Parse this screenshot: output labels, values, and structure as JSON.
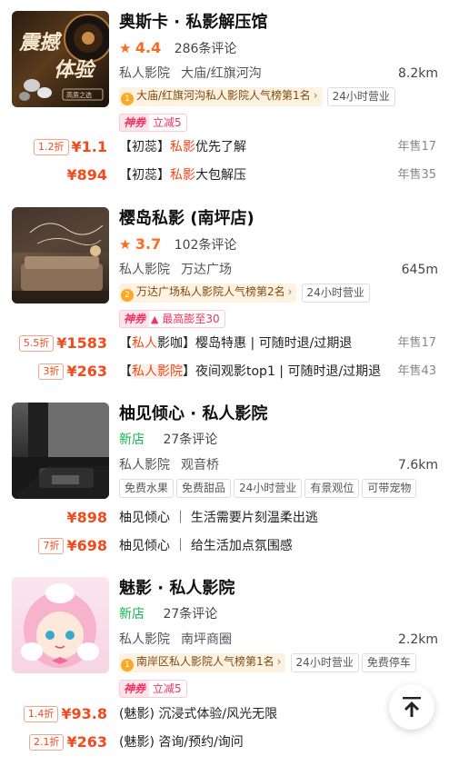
{
  "shops": [
    {
      "name": "奥斯卡 · 私影解压馆",
      "rating": "4.4",
      "reviews": "286条评论",
      "category": "私人影院",
      "area": "大庙/红旗河沟",
      "distance": "8.2km",
      "rank": "大庙/红旗河沟私人影院人气榜第1名",
      "tags": [
        "24小时营业"
      ],
      "promo": {
        "label": "神券",
        "value": "立减5"
      },
      "thumb_text": [
        "震撼",
        "体验",
        "高质之选"
      ],
      "deals": [
        {
          "discount": "1.2折",
          "price": "¥1.1",
          "prefix": "【初蕊】",
          "highlight": "私影",
          "suffix": "优先了解",
          "sold": "年售17"
        },
        {
          "discount": "",
          "price": "¥894",
          "prefix": "【初蕊】",
          "highlight": "私影",
          "suffix": "大包解压",
          "sold": "年售35"
        }
      ]
    },
    {
      "name": "樱岛私影 (南坪店)",
      "rating": "3.7",
      "reviews": "102条评论",
      "category": "私人影院",
      "area": "万达广场",
      "distance": "645m",
      "rank": "万达广场私人影院人气榜第2名",
      "tags": [
        "24小时营业"
      ],
      "promo": {
        "label": "神券",
        "value": "最高膨至30"
      },
      "deals": [
        {
          "discount": "5.5折",
          "price": "¥1583",
          "prefix": "【",
          "highlight": "私人",
          "suffix": "影咖】樱岛特惠 | 可随时退/过期退",
          "sold": "年售17"
        },
        {
          "discount": "3折",
          "price": "¥263",
          "prefix": "【",
          "highlight": "私人影院",
          "suffix": "】夜间观影top1 | 可随时退/过期退",
          "sold": "年售43"
        }
      ]
    },
    {
      "name": "柚见倾心 · 私人影院",
      "new": "新店",
      "reviews": "27条评论",
      "category": "私人影院",
      "area": "观音桥",
      "distance": "7.6km",
      "tags": [
        "免费水果",
        "免费甜品",
        "24小时营业",
        "有景观位",
        "可带宠物"
      ],
      "deals": [
        {
          "discount": "",
          "price": "¥898",
          "prefix": "柚见倾心 ｜ 生活需要片刻温柔出逃",
          "highlight": "",
          "suffix": "",
          "sold": ""
        },
        {
          "discount": "7折",
          "price": "¥698",
          "prefix": "柚见倾心 ｜ 给生活加点氛围感",
          "highlight": "",
          "suffix": "",
          "sold": ""
        }
      ]
    },
    {
      "name": "魅影 · 私人影院",
      "new": "新店",
      "reviews": "27条评论",
      "category": "私人影院",
      "area": "南坪商圈",
      "distance": "2.2km",
      "rank": "南岸区私人影院人气榜第1名",
      "tags": [
        "24小时营业",
        "免费停车"
      ],
      "promo": {
        "label": "神券",
        "value": "立减5"
      },
      "deals": [
        {
          "discount": "1.4折",
          "price": "¥93.8",
          "prefix": "(魅影) 沉浸式体验/风光无限",
          "highlight": "",
          "suffix": "",
          "sold": ""
        },
        {
          "discount": "2.1折",
          "price": "¥263",
          "prefix": "(魅影) 咨询/预约/询问",
          "highlight": "",
          "suffix": "",
          "sold": ""
        }
      ]
    }
  ],
  "icons": {
    "star": "star-icon",
    "medal": "medal-icon",
    "back_to_top": "arrow-up-to-top-icon"
  },
  "colors": {
    "price": "#f24a1d",
    "rating": "#ff6a1f",
    "new": "#13b557",
    "promo": "#f2325f"
  }
}
